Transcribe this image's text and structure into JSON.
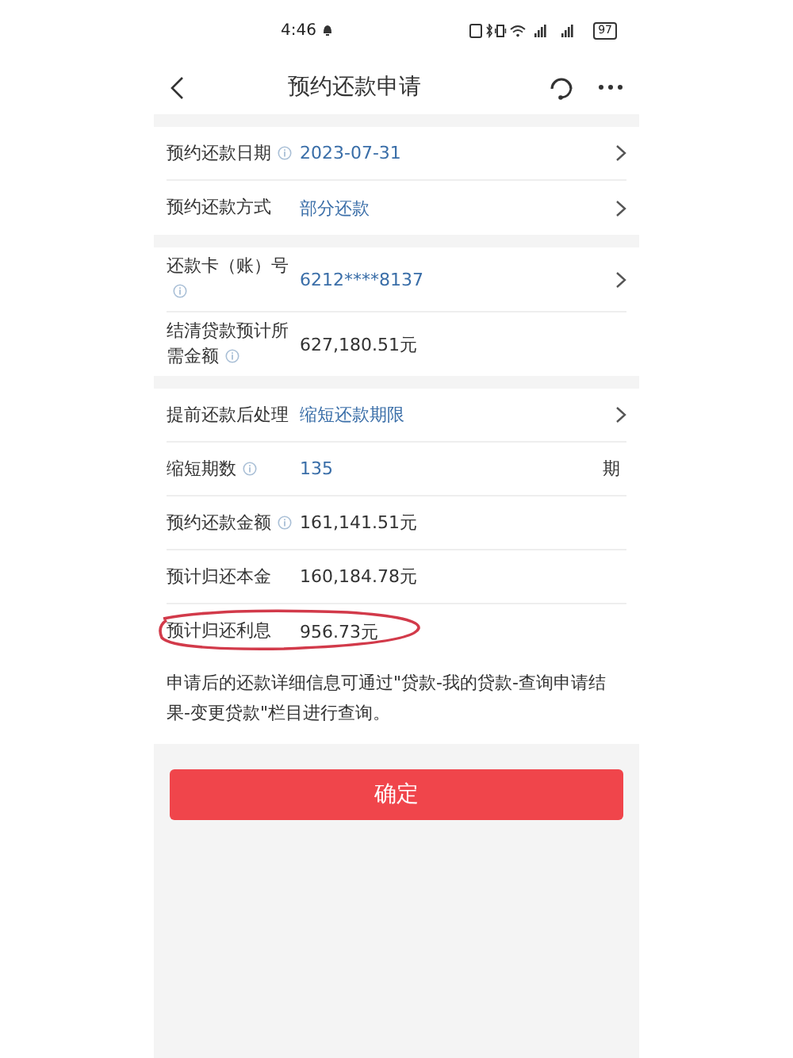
{
  "status_bar": {
    "time": "4:46",
    "battery": "97"
  },
  "nav": {
    "title": "预约还款申请"
  },
  "sections": [
    {
      "rows": [
        {
          "kind": "select",
          "label": "预约还款日期",
          "info": true,
          "value": "2023-07-31"
        },
        {
          "kind": "select",
          "label": "预约还款方式",
          "info": false,
          "value": "部分还款"
        }
      ]
    },
    {
      "rows": [
        {
          "kind": "select",
          "label": "还款卡（账）号",
          "info": true,
          "value": "6212****8137"
        },
        {
          "kind": "display",
          "label": "结清贷款预计所需金额",
          "info": true,
          "value": "627,180.51元"
        }
      ]
    },
    {
      "rows": [
        {
          "kind": "select",
          "label": "提前还款后处理",
          "info": false,
          "value": "缩短还款期限"
        },
        {
          "kind": "input",
          "label": "缩短期数",
          "info": true,
          "value": "135",
          "unit": "期"
        },
        {
          "kind": "display",
          "label": "预约还款金额",
          "info": true,
          "value": "161,141.51元"
        },
        {
          "kind": "display",
          "label": "预计归还本金",
          "info": false,
          "value": "160,184.78元"
        },
        {
          "kind": "display",
          "label": "预计归还利息",
          "info": false,
          "value": "956.73元",
          "circled": true
        }
      ]
    }
  ],
  "note": "申请后的还款详细信息可通过\"贷款-我的贷款-查询申请结果-变更贷款\"栏目进行查询。",
  "confirm_button": "确定"
}
